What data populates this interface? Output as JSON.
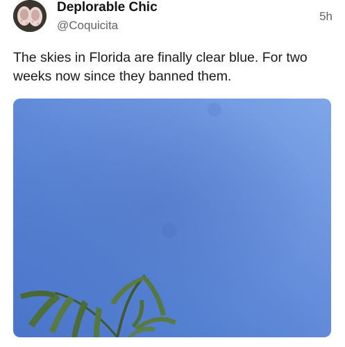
{
  "post": {
    "author": {
      "display_name": "Deplorable Chic",
      "handle": "@Coquicita",
      "avatar_icon": "slippers-photo-avatar"
    },
    "timestamp": "5h",
    "text": "The skies in Florida are finally clear blue. For two weeks now since they banned them.",
    "media": {
      "icon": "sky-photo",
      "description_colors": {
        "sky_top_right": "#7ba2e6",
        "sky_mid": "#5680d2",
        "palm_green": "#4d6a3a"
      }
    }
  }
}
